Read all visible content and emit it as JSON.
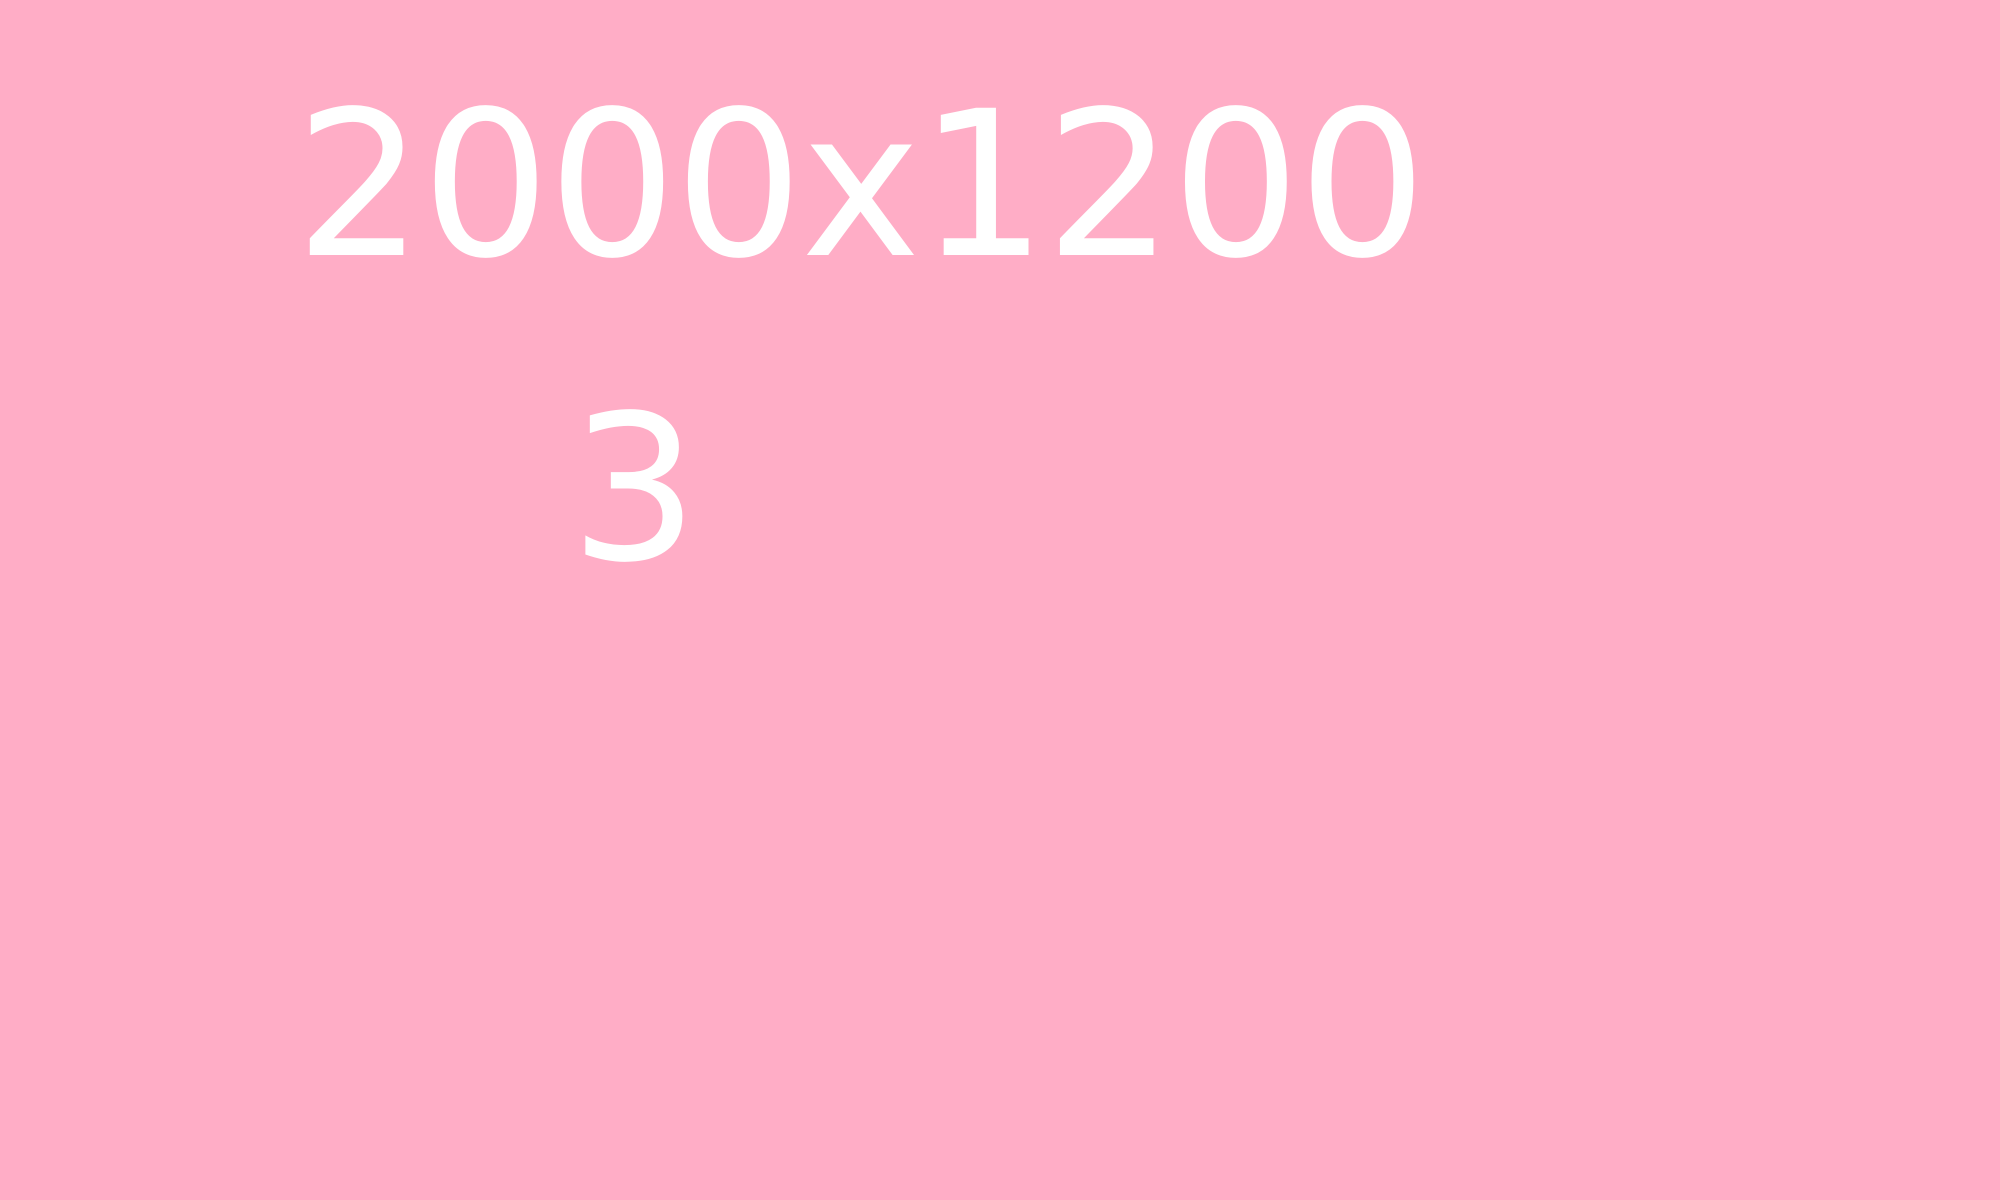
{
  "background_color": "#FFADC6",
  "text_color": "#FFFFFF",
  "dimensions_label": "2000x1200",
  "number_label": "3"
}
